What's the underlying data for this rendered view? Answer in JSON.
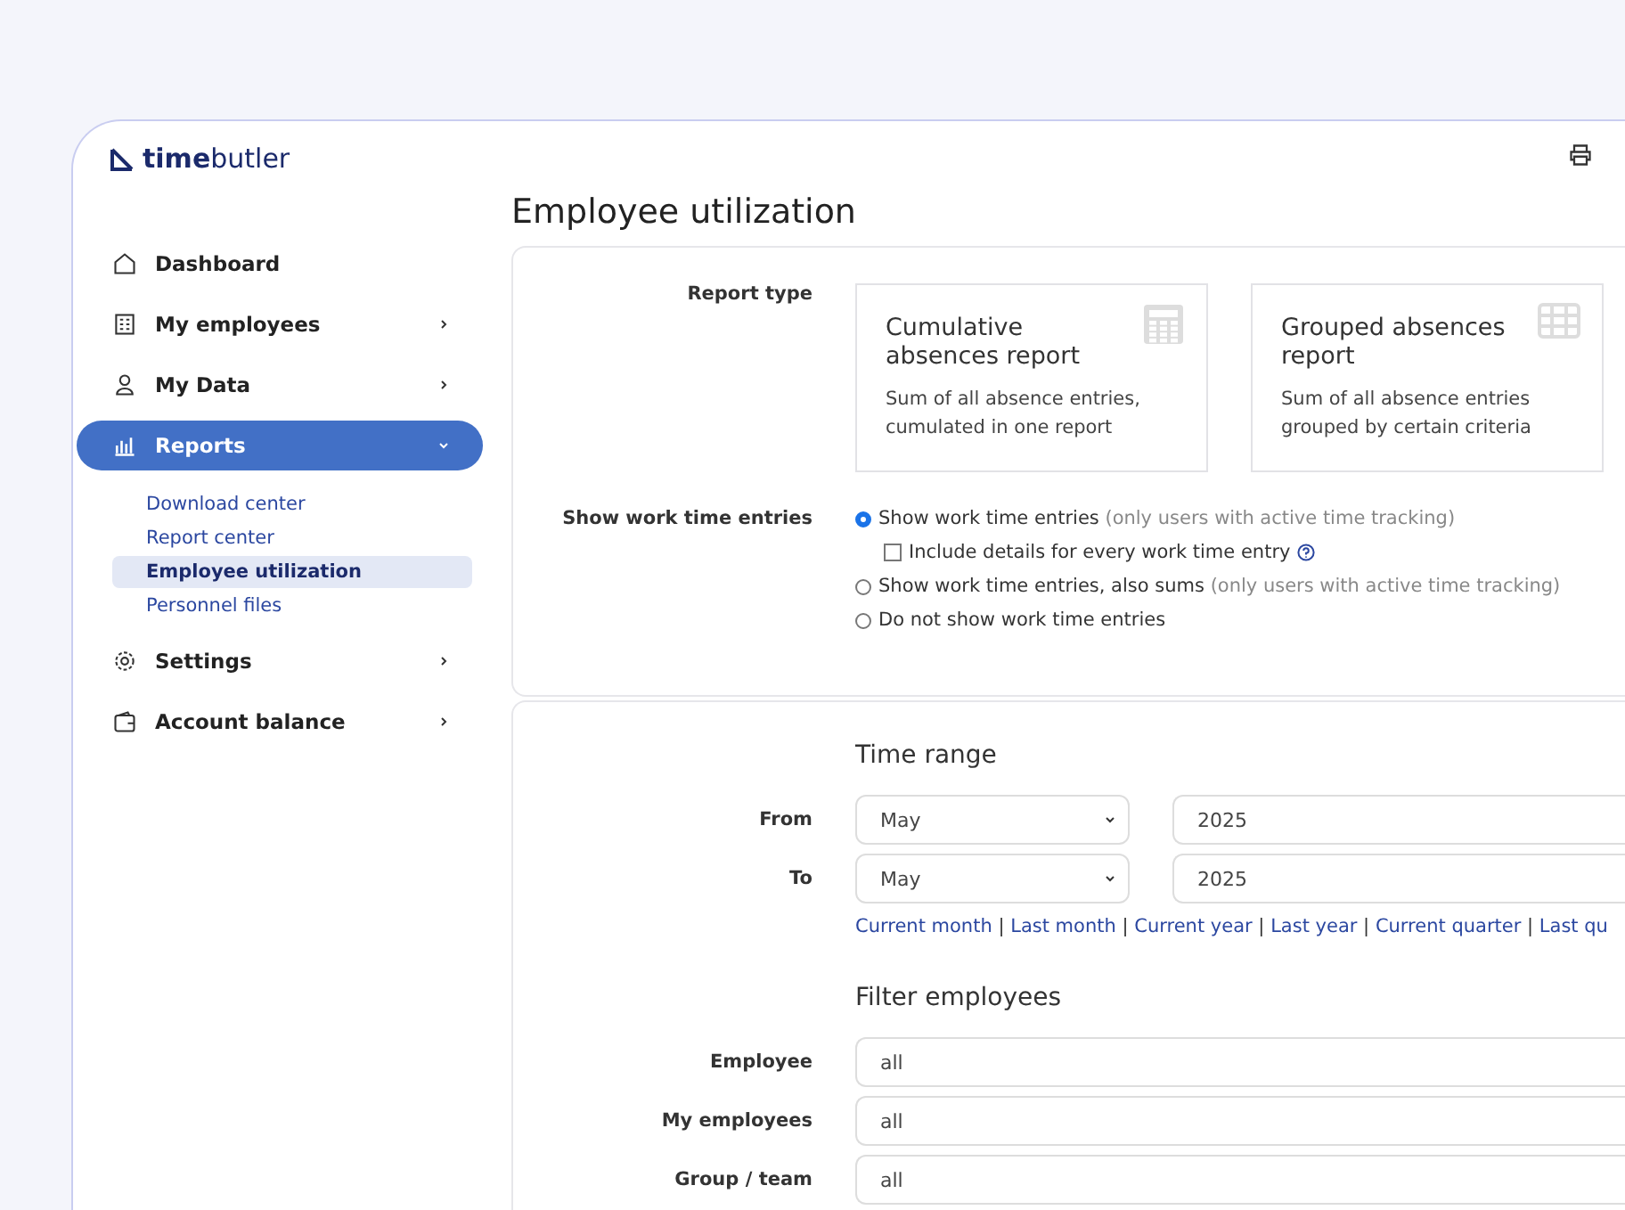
{
  "brand": {
    "bold": "time",
    "light": "butler"
  },
  "sidebar": {
    "items": [
      {
        "kind": "link",
        "label": "Dashboard",
        "selected": false
      },
      {
        "kind": "group",
        "label": "My employees",
        "expanded": false,
        "selected": false
      },
      {
        "kind": "group",
        "label": "My Data",
        "expanded": false,
        "selected": false
      },
      {
        "kind": "group",
        "label": "Reports",
        "expanded": true,
        "selected": true,
        "children": [
          {
            "label": "Download center",
            "selected": false
          },
          {
            "label": "Report center",
            "selected": false
          },
          {
            "label": "Employee utilization",
            "selected": true
          },
          {
            "label": "Personnel files",
            "selected": false
          }
        ]
      },
      {
        "kind": "group",
        "label": "Settings",
        "expanded": false,
        "selected": false
      },
      {
        "kind": "group",
        "label": "Account balance",
        "expanded": false,
        "selected": false
      }
    ]
  },
  "page_title": "Employee utilization",
  "report_type": {
    "label": "Report type",
    "options": [
      {
        "title": "Cumulative absences report",
        "description": "Sum of all absence entries, cumulated in one report"
      },
      {
        "title": "Grouped absences report",
        "description": "Sum of all absence entries grouped by certain criteria"
      }
    ]
  },
  "work_time": {
    "label": "Show work time entries",
    "options": [
      {
        "kind": "radio",
        "label": "Show work time entries",
        "note": "(only users with active time tracking)",
        "selected": true
      },
      {
        "kind": "checkbox",
        "label": "Include details for every work time entry",
        "checked": false
      },
      {
        "kind": "radio",
        "label": "Show work time entries, also sums",
        "note": "(only users with active time tracking)",
        "selected": false
      },
      {
        "kind": "radio",
        "label": "Do not show work time entries",
        "selected": false
      }
    ]
  },
  "time_range": {
    "heading": "Time range",
    "rows": [
      {
        "label": "From",
        "month": "May",
        "year": "2025"
      },
      {
        "label": "To",
        "month": "May",
        "year": "2025"
      }
    ],
    "separator": "|",
    "shortcuts": [
      "Current month",
      "Last month",
      "Current year",
      "Last year",
      "Current quarter",
      "Last qu"
    ]
  },
  "filter": {
    "heading": "Filter employees",
    "rows": [
      {
        "label": "Employee",
        "value": "all"
      },
      {
        "label": "My employees",
        "value": "all"
      },
      {
        "label": "Group / team",
        "value": "all"
      }
    ]
  }
}
